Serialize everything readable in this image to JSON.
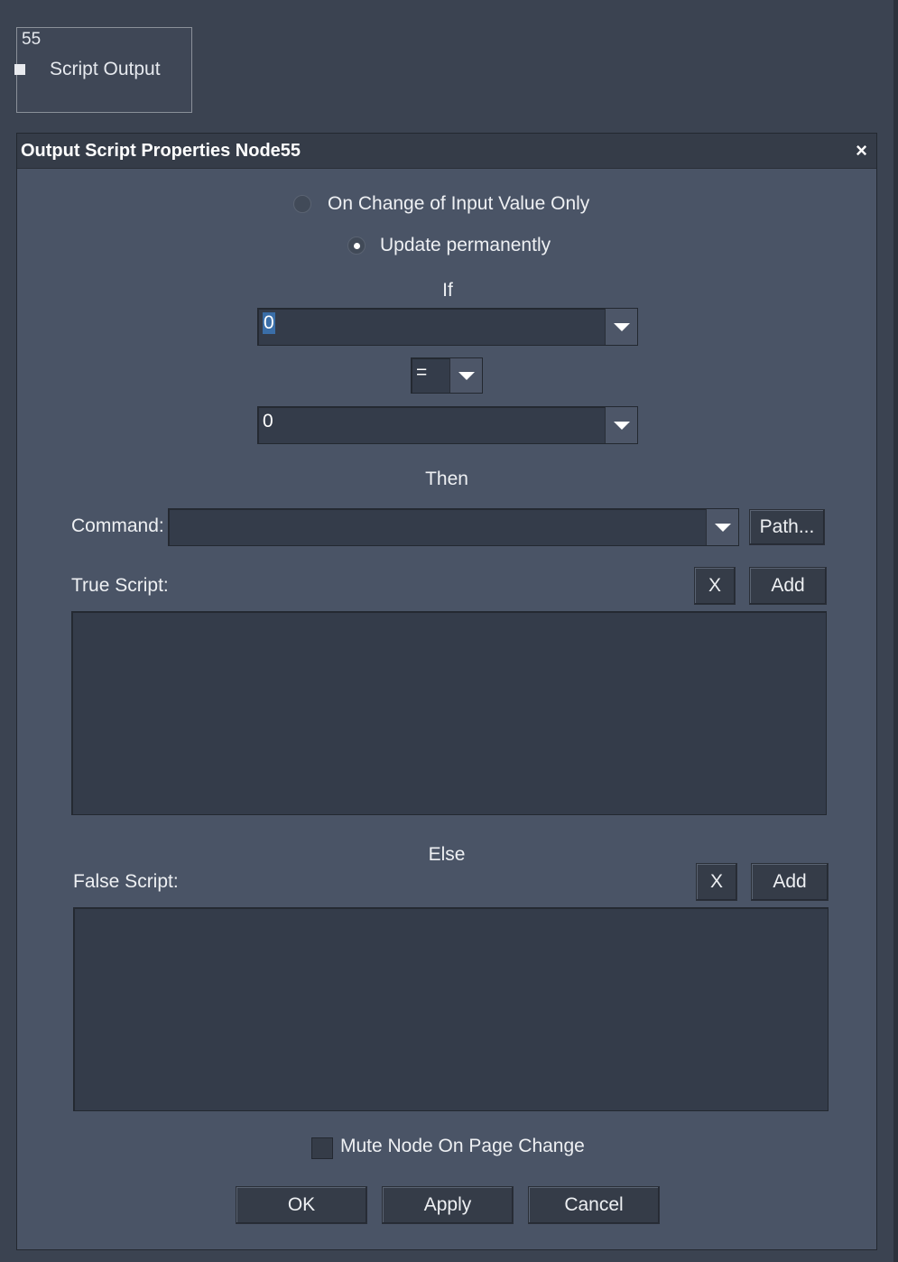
{
  "node": {
    "id": "55",
    "label": "Script Output"
  },
  "dialog": {
    "title": "Output Script Properties Node55",
    "close_symbol": "×",
    "radio_on_change_label": "On Change of Input Value Only",
    "radio_update_label": "Update permanently",
    "radio_selected": "Update permanently",
    "if_label": "If",
    "condition_left_value": "0",
    "operator_value": "=",
    "condition_right_value": "0",
    "then_label": "Then",
    "command_label": "Command:",
    "command_value": "",
    "path_button": "Path...",
    "true_script_label": "True Script:",
    "true_clear_button": "X",
    "true_add_button": "Add",
    "true_script_value": "",
    "else_label": "Else",
    "false_script_label": "False Script:",
    "false_clear_button": "X",
    "false_add_button": "Add",
    "false_script_value": "",
    "mute_label": "Mute Node On Page Change",
    "mute_checked": false,
    "ok_button": "OK",
    "apply_button": "Apply",
    "cancel_button": "Cancel"
  },
  "icons": {
    "dropdown": "chevron-down-icon",
    "close": "close-icon",
    "port": "port-icon"
  }
}
